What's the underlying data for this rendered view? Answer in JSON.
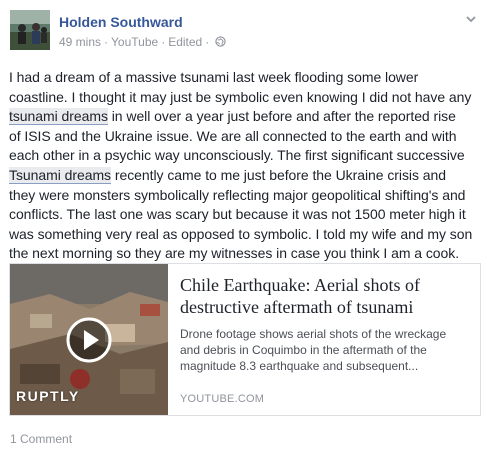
{
  "author": {
    "name": "Holden Southward",
    "avatar_icon": "profile-photo-icon"
  },
  "meta": {
    "time": "49 mins",
    "source": "YouTube",
    "status": "Edited",
    "separator": "·",
    "privacy_icon": "globe-icon"
  },
  "post": {
    "lines": [
      "I had a dream of a massive tsunami last week flooding some lower",
      "coastline. I thought it may just be symbolic even knowing I did not have any",
      [
        "",
        "tsunami dreams",
        " in well over a year just before and after the reported rise"
      ],
      "of ISIS and the Ukraine issue. We are all connected to the earth and with",
      "each other in a psychic way unconsciously. The first significant successive",
      [
        "",
        "Tsunami dreams",
        " recently came to me just before the Ukraine crisis and"
      ],
      "they were monsters symbolically reflecting major geopolitical shifting's and",
      "conflicts. The last one was scary but because it was not 1500 meter high it",
      "was something very real as opposed to symbolic. I told my wife and my son",
      "the next morning so they are my witnesses in case you think I am a cook."
    ]
  },
  "link_card": {
    "title_lines": [
      "Chile Earthquake: Aerial shots of",
      "destructive aftermath of tsunami"
    ],
    "description_lines": [
      "Drone footage shows aerial shots of the wreckage",
      "and debris in Coquimbo in the aftermath of the",
      "magnitude 8.3 earthquake and subsequent..."
    ],
    "source": "YOUTUBE.COM",
    "thumbnail_label": "RUPTLY",
    "play_icon": "play-icon"
  },
  "footer": {
    "comments": "1 Comment"
  },
  "colors": {
    "link": "#365899",
    "muted": "#90949c",
    "text": "#1d2129",
    "highlight": "#e9ebee"
  }
}
